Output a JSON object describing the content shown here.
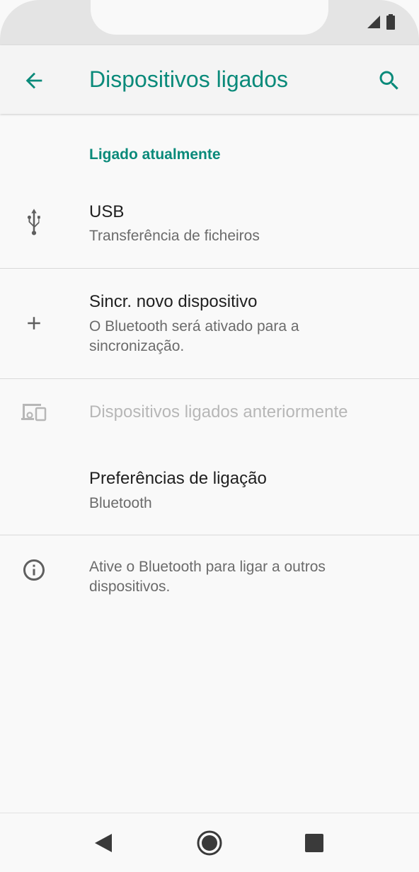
{
  "app_bar": {
    "title": "Dispositivos ligados",
    "back_icon": "arrow-left-icon",
    "search_icon": "search-icon",
    "accent_color": "#0a8a7a"
  },
  "status_bar": {
    "icons": [
      "signal-icon",
      "battery-icon"
    ]
  },
  "section": {
    "header": "Ligado atualmente"
  },
  "items": [
    {
      "icon": "usb-icon",
      "title": "USB",
      "subtitle": "Transferência de ficheiros"
    },
    {
      "icon": "plus-icon",
      "title": "Sincr. novo dispositivo",
      "subtitle": "O Bluetooth será ativado para a sincronização."
    },
    {
      "icon": "devices-icon",
      "title": "Dispositivos ligados anteriormente",
      "disabled": true
    },
    {
      "title": "Preferências de ligação",
      "subtitle": "Bluetooth"
    }
  ],
  "info": {
    "icon": "info-icon",
    "text": "Ative o Bluetooth para ligar a outros dispositivos."
  },
  "nav_bar": {
    "buttons": [
      "back-triangle-icon",
      "home-circle-icon",
      "recents-square-icon"
    ]
  }
}
